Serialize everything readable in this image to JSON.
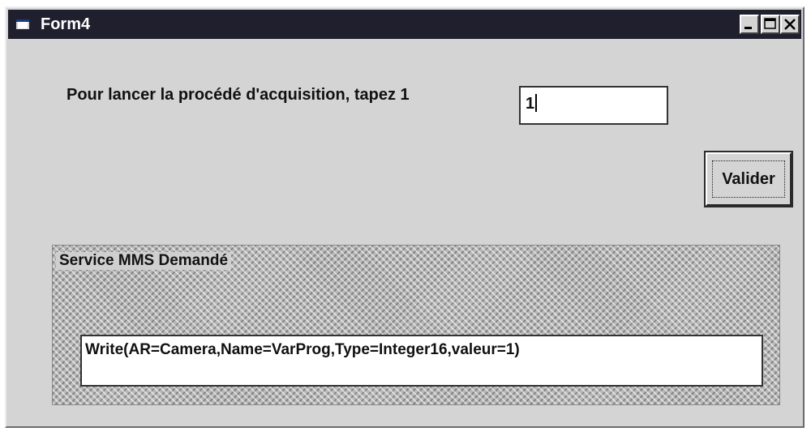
{
  "window": {
    "title": "Form4",
    "controls": {
      "minimize_icon": "minimize-icon",
      "maximize_icon": "maximize-icon",
      "close_icon": "close-icon"
    }
  },
  "prompt": {
    "label": "Pour lancer la procédé d'acquisition, tapez 1",
    "input_value": "1"
  },
  "buttons": {
    "validate_label": "Valider"
  },
  "service_group": {
    "title": "Service MMS Demandé",
    "value": "Write(AR=Camera,Name=VarProg,Type=Integer16,valeur=1)"
  },
  "colors": {
    "titlebar": "#1f1f2e",
    "face": "#d4d4d4",
    "field": "#ffffff"
  }
}
